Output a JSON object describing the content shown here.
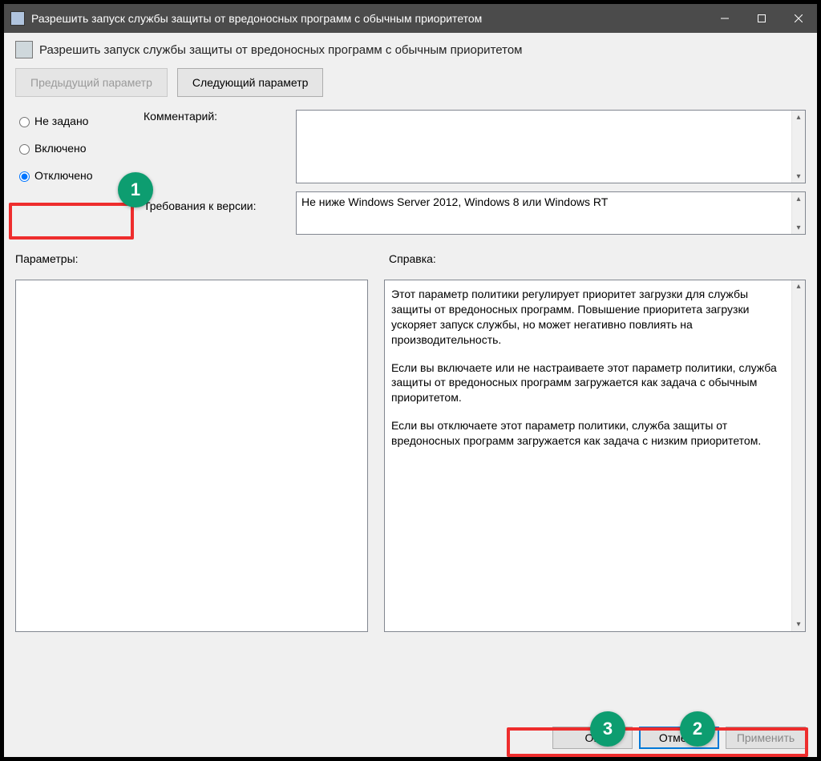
{
  "titlebar": {
    "title": "Разрешить запуск службы защиты от вредоносных программ с обычным приоритетом"
  },
  "header": {
    "title": "Разрешить запуск службы защиты от вредоносных программ с обычным приоритетом"
  },
  "nav": {
    "prev": "Предыдущий параметр",
    "next": "Следующий параметр"
  },
  "radios": {
    "not_configured": "Не задано",
    "enabled": "Включено",
    "disabled": "Отключено",
    "selected": "disabled"
  },
  "labels": {
    "comment": "Комментарий:",
    "supported": "Требования к версии:",
    "options": "Параметры:",
    "help": "Справка:"
  },
  "comment_text": "",
  "supported_text": "Не ниже Windows Server 2012, Windows 8 или Windows RT",
  "help_paragraphs": [
    "Этот параметр политики регулирует приоритет загрузки для службы защиты от вредоносных программ. Повышение приоритета загрузки ускоряет запуск службы, но может негативно повлиять на производительность.",
    "Если вы включаете или не настраиваете этот параметр политики, служба защиты от вредоносных программ загружается как задача с обычным приоритетом.",
    "Если вы отключаете этот параметр политики, служба защиты от вредоносных программ загружается как задача с низким приоритетом."
  ],
  "footer": {
    "ok": "ОК",
    "cancel": "Отмена",
    "apply": "Применить"
  },
  "annotations": {
    "n1": "1",
    "n2": "2",
    "n3": "3"
  }
}
